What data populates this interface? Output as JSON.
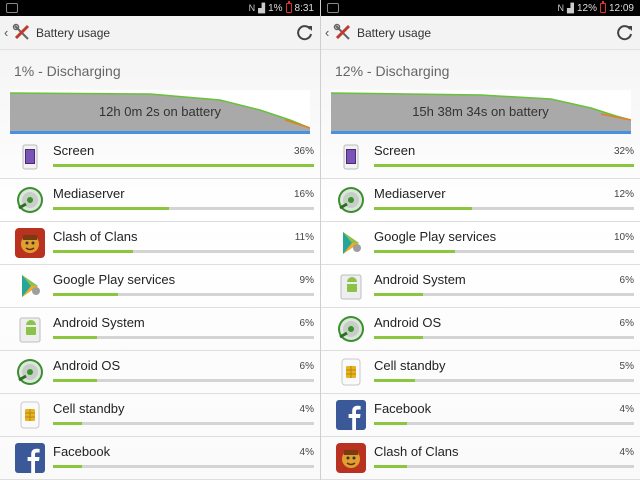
{
  "colors": {
    "accent": "#8cc63f",
    "track": "#d4d4d4",
    "graph_fill": "#a9a9a9",
    "graph_line": "#67c23a",
    "graph_base": "#4a90e2"
  },
  "screens": [
    {
      "status": {
        "signal": "N",
        "battery": "1%",
        "time": "8:31"
      },
      "actionbar": {
        "title": "Battery usage"
      },
      "subtitle": "1% - Discharging",
      "graph_label": "12h 0m 2s on battery",
      "items": [
        {
          "name": "Screen",
          "pct": "36%",
          "level": 0.36,
          "icon": "screen-icon"
        },
        {
          "name": "Mediaserver",
          "pct": "16%",
          "level": 0.16,
          "icon": "mediaserver-icon"
        },
        {
          "name": "Clash of Clans",
          "pct": "11%",
          "level": 0.11,
          "icon": "clash-of-clans-icon"
        },
        {
          "name": "Google Play services",
          "pct": "9%",
          "level": 0.09,
          "icon": "google-play-services-icon"
        },
        {
          "name": "Android System",
          "pct": "6%",
          "level": 0.06,
          "icon": "android-system-icon"
        },
        {
          "name": "Android OS",
          "pct": "6%",
          "level": 0.06,
          "icon": "android-os-icon"
        },
        {
          "name": "Cell standby",
          "pct": "4%",
          "level": 0.04,
          "icon": "cell-standby-icon"
        },
        {
          "name": "Facebook",
          "pct": "4%",
          "level": 0.04,
          "icon": "facebook-icon"
        }
      ]
    },
    {
      "status": {
        "signal": "N",
        "battery": "12%",
        "time": "12:09"
      },
      "actionbar": {
        "title": "Battery usage"
      },
      "subtitle": "12% - Discharging",
      "graph_label": "15h 38m 34s on battery",
      "items": [
        {
          "name": "Screen",
          "pct": "32%",
          "level": 0.32,
          "icon": "screen-icon"
        },
        {
          "name": "Mediaserver",
          "pct": "12%",
          "level": 0.12,
          "icon": "mediaserver-icon"
        },
        {
          "name": "Google Play services",
          "pct": "10%",
          "level": 0.1,
          "icon": "google-play-services-icon"
        },
        {
          "name": "Android System",
          "pct": "6%",
          "level": 0.06,
          "icon": "android-system-icon"
        },
        {
          "name": "Android OS",
          "pct": "6%",
          "level": 0.06,
          "icon": "android-os-icon"
        },
        {
          "name": "Cell standby",
          "pct": "5%",
          "level": 0.05,
          "icon": "cell-standby-icon"
        },
        {
          "name": "Facebook",
          "pct": "4%",
          "level": 0.04,
          "icon": "facebook-icon"
        },
        {
          "name": "Clash of Clans",
          "pct": "4%",
          "level": 0.04,
          "icon": "clash-of-clans-icon"
        }
      ]
    }
  ]
}
